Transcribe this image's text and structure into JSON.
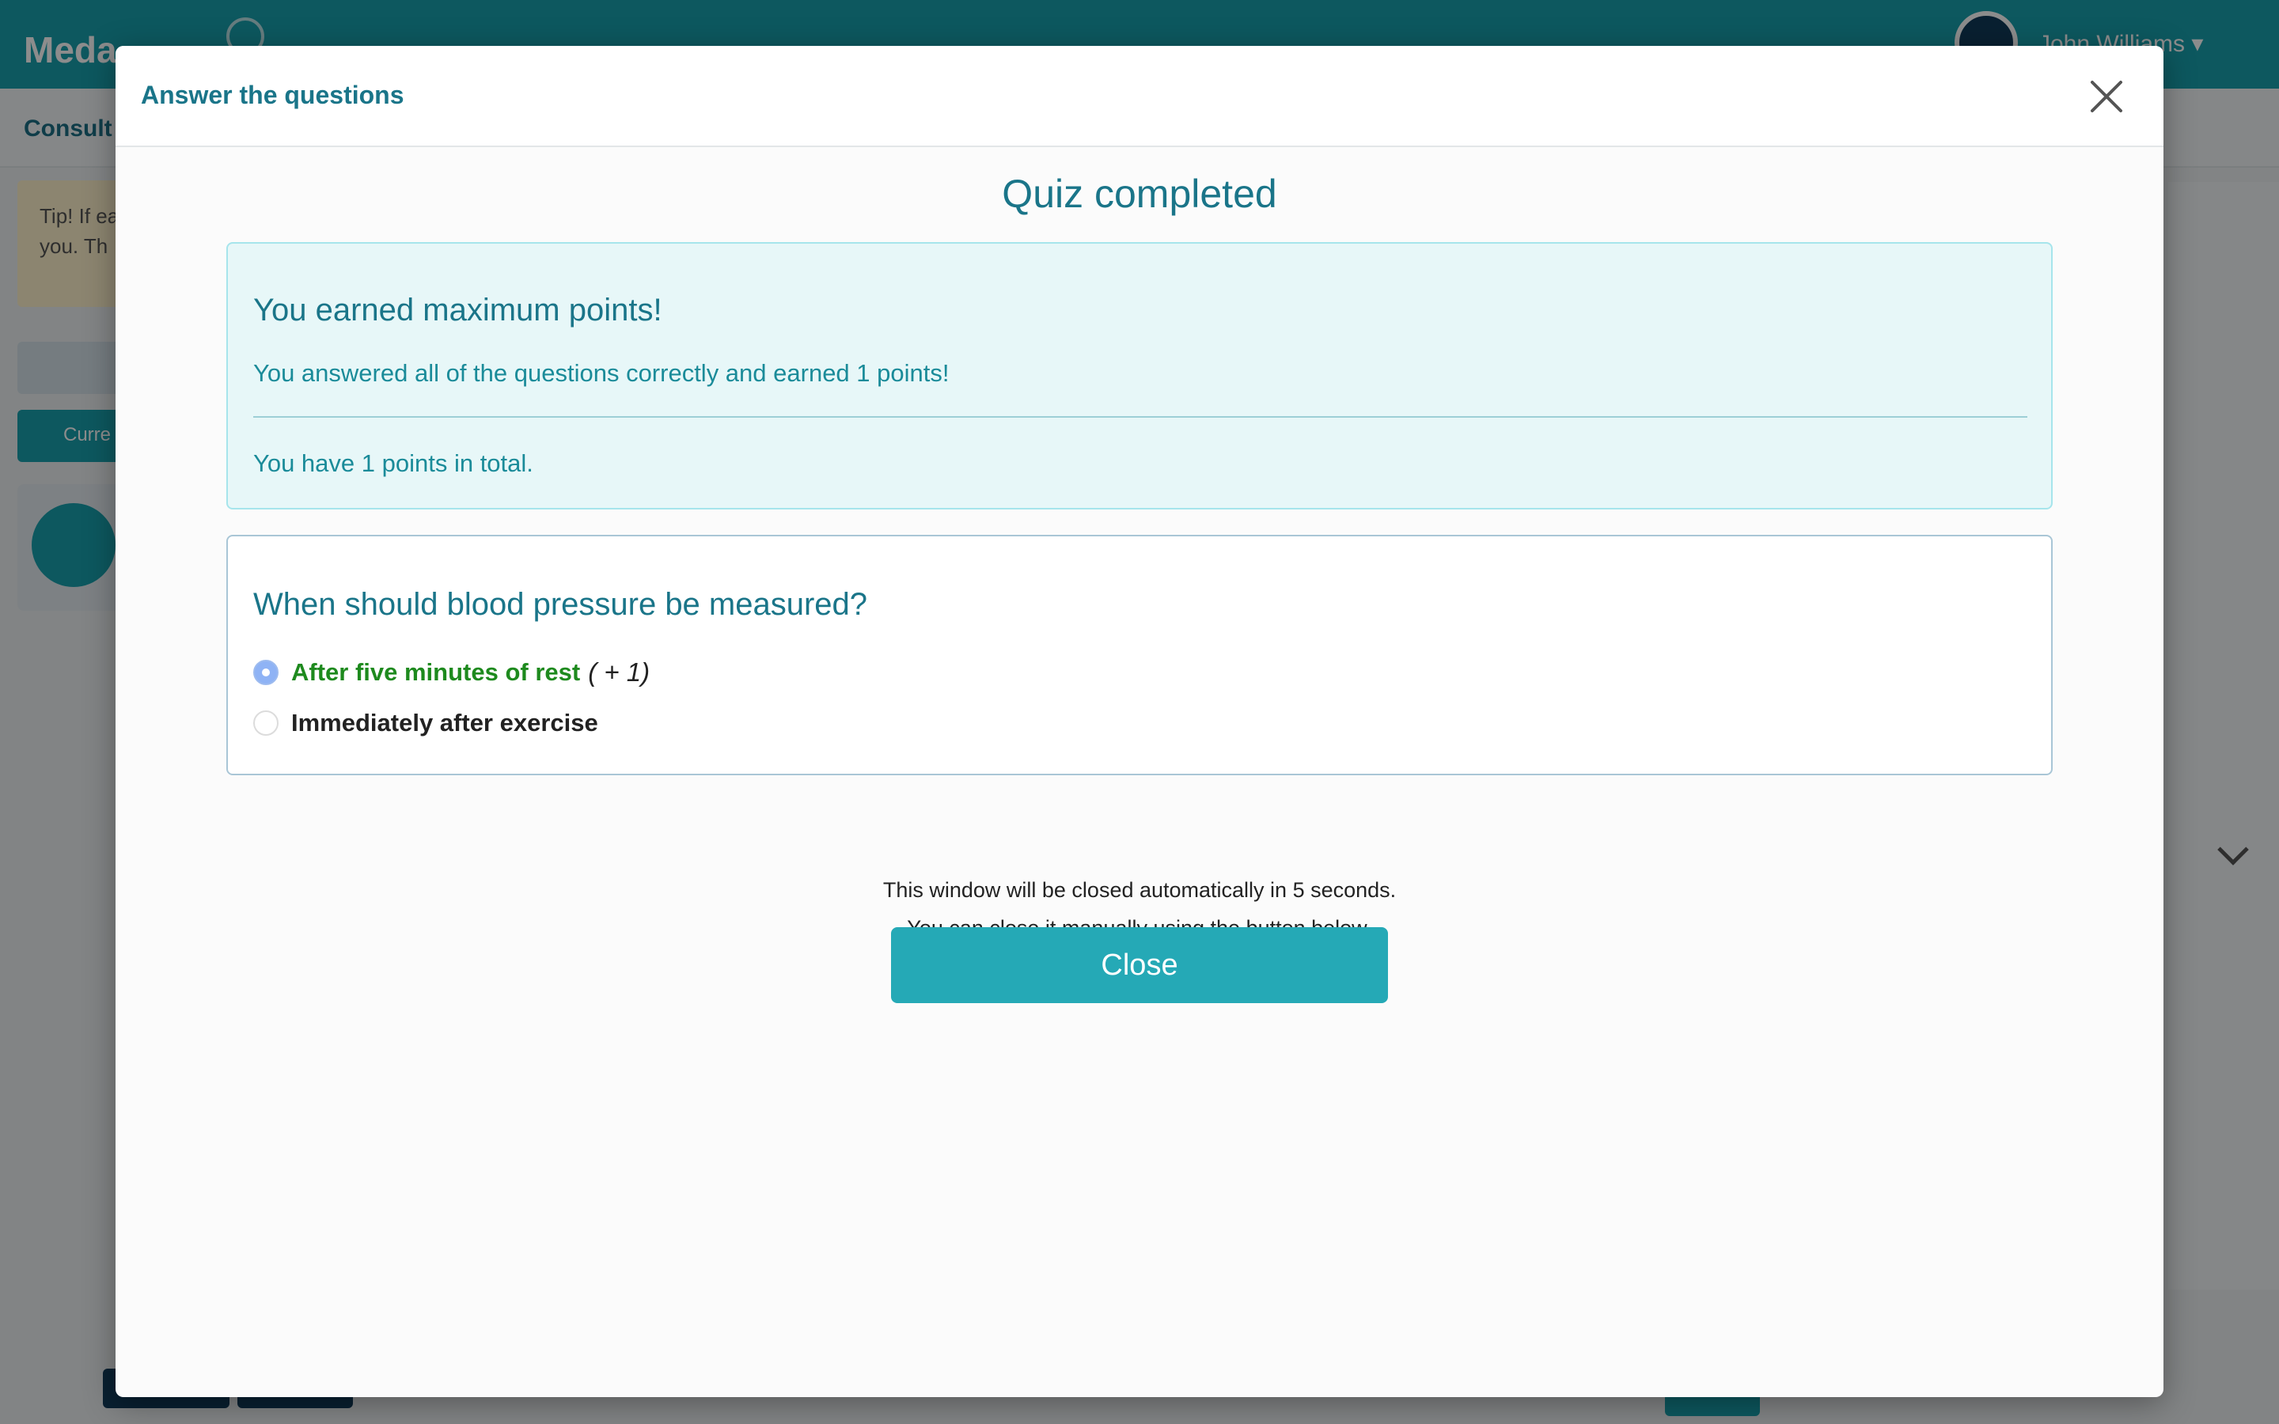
{
  "background": {
    "logo": "Meda",
    "username": "John Williams ▾",
    "subbar": "Consult",
    "tip": "Tip! If easier t you. Th",
    "teal_button": "Curre"
  },
  "modal": {
    "title": "Answer the questions",
    "heading": "Quiz completed",
    "result": {
      "title": "You earned maximum points!",
      "message": "You answered all of the questions correctly and earned 1 points!",
      "total": "You have 1 points in total."
    },
    "question": {
      "text": "When should blood pressure be measured?",
      "answers": [
        {
          "label": "After five minutes of rest",
          "points": "( + 1)",
          "selected": true,
          "correct": true
        },
        {
          "label": "Immediately after exercise",
          "points": "",
          "selected": false,
          "correct": false
        }
      ]
    },
    "auto_close_line1": "This window will be closed automatically in 5 seconds.",
    "auto_close_line2": "You can close it manually using the button below.",
    "close_button_label": "Close"
  },
  "colors": {
    "primary": "#19a0ae",
    "heading": "#1a7589",
    "correct": "#1e8a1e"
  }
}
